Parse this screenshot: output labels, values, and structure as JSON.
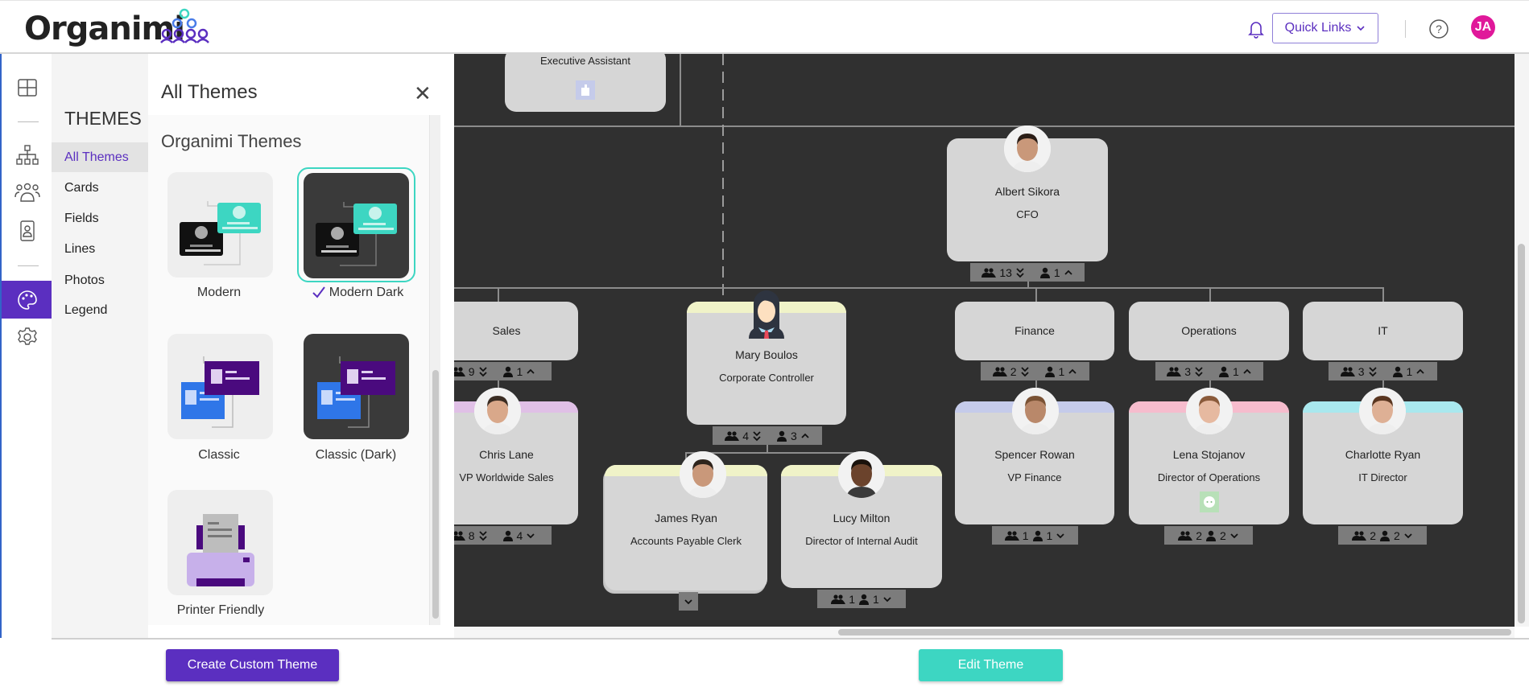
{
  "header": {
    "logo": "Organimi",
    "quick_links": "Quick Links",
    "avatar_initials": "JA",
    "icons": [
      "bell-icon",
      "chevron-down-icon",
      "help-icon"
    ],
    "colors": {
      "brand": "#5b2fc0",
      "accent": "#3dd6c2",
      "avatar": "#e0189a"
    }
  },
  "rail": {
    "icons": [
      "grid-icon",
      "org-chart-icon",
      "people-icon",
      "directory-icon",
      "palette-icon",
      "gear-icon"
    ],
    "active": "palette-icon"
  },
  "themes_nav": {
    "title": "THEMES",
    "items": [
      "All Themes",
      "Cards",
      "Fields",
      "Lines",
      "Photos",
      "Legend"
    ],
    "active": "All Themes"
  },
  "panel": {
    "title": "All Themes",
    "section": "Organimi Themes",
    "themes": [
      {
        "label": "Modern",
        "selected": false
      },
      {
        "label": "Modern Dark",
        "selected": true
      },
      {
        "label": "Classic",
        "selected": false
      },
      {
        "label": "Classic (Dark)",
        "selected": false
      },
      {
        "label": "Printer Friendly",
        "selected": false
      }
    ]
  },
  "chart": {
    "cards": [
      {
        "id": "exec",
        "title": "Executive Assistant",
        "icon": "building-icon"
      },
      {
        "id": "albert",
        "name": "Albert Sikora",
        "title": "CFO",
        "badge": {
          "members": "13",
          "members_chev": "double-down",
          "direct": "1",
          "direct_chev": "up"
        }
      },
      {
        "id": "sales",
        "name": "Sales",
        "badge": {
          "members": "9",
          "members_chev": "double-down",
          "direct": "1",
          "direct_chev": "up"
        }
      },
      {
        "id": "mary",
        "name": "Mary Boulos",
        "title": "Corporate Controller",
        "strip": "#f0f3c8",
        "badge": {
          "members": "4",
          "members_chev": "double-down",
          "direct": "3",
          "direct_chev": "up"
        }
      },
      {
        "id": "finance",
        "name": "Finance",
        "badge": {
          "members": "2",
          "members_chev": "double-down",
          "direct": "1",
          "direct_chev": "up"
        }
      },
      {
        "id": "operations",
        "name": "Operations",
        "badge": {
          "members": "3",
          "members_chev": "double-down",
          "direct": "1",
          "direct_chev": "up"
        }
      },
      {
        "id": "it",
        "name": "IT",
        "badge": {
          "members": "3",
          "members_chev": "double-down",
          "direct": "1",
          "direct_chev": "up"
        }
      },
      {
        "id": "chris",
        "name": "Chris Lane",
        "title": "VP Worldwide Sales",
        "strip": "#e0c0e6",
        "badge": {
          "members": "8",
          "members_chev": "double-down",
          "direct": "4",
          "direct_chev": "down"
        }
      },
      {
        "id": "spencer",
        "name": "Spencer Rowan",
        "title": "VP Finance",
        "strip": "#c5cbea",
        "badge": {
          "members": "1",
          "direct": "1",
          "direct_chev": "down"
        }
      },
      {
        "id": "lena",
        "name": "Lena Stojanov",
        "title": "Director of Operations",
        "strip": "#f6bccd",
        "icon": "face-icon",
        "badge": {
          "members": "2",
          "direct": "2",
          "direct_chev": "down"
        }
      },
      {
        "id": "charlotte",
        "name": "Charlotte Ryan",
        "title": "IT Director",
        "strip": "#a9e8ee",
        "badge": {
          "members": "2",
          "direct": "2",
          "direct_chev": "down"
        }
      },
      {
        "id": "james",
        "name": "James Ryan",
        "title": "Accounts Payable Clerk",
        "strip": "#f0f3c8",
        "badge": {
          "direct_chev": "down"
        }
      },
      {
        "id": "lucy",
        "name": "Lucy Milton",
        "title": "Director of Internal Audit",
        "strip": "#f0f3c8",
        "badge": {
          "members": "1",
          "direct": "1",
          "direct_chev": "down"
        }
      }
    ]
  },
  "footer": {
    "create_custom_theme": "Create Custom Theme",
    "edit_theme": "Edit Theme"
  }
}
